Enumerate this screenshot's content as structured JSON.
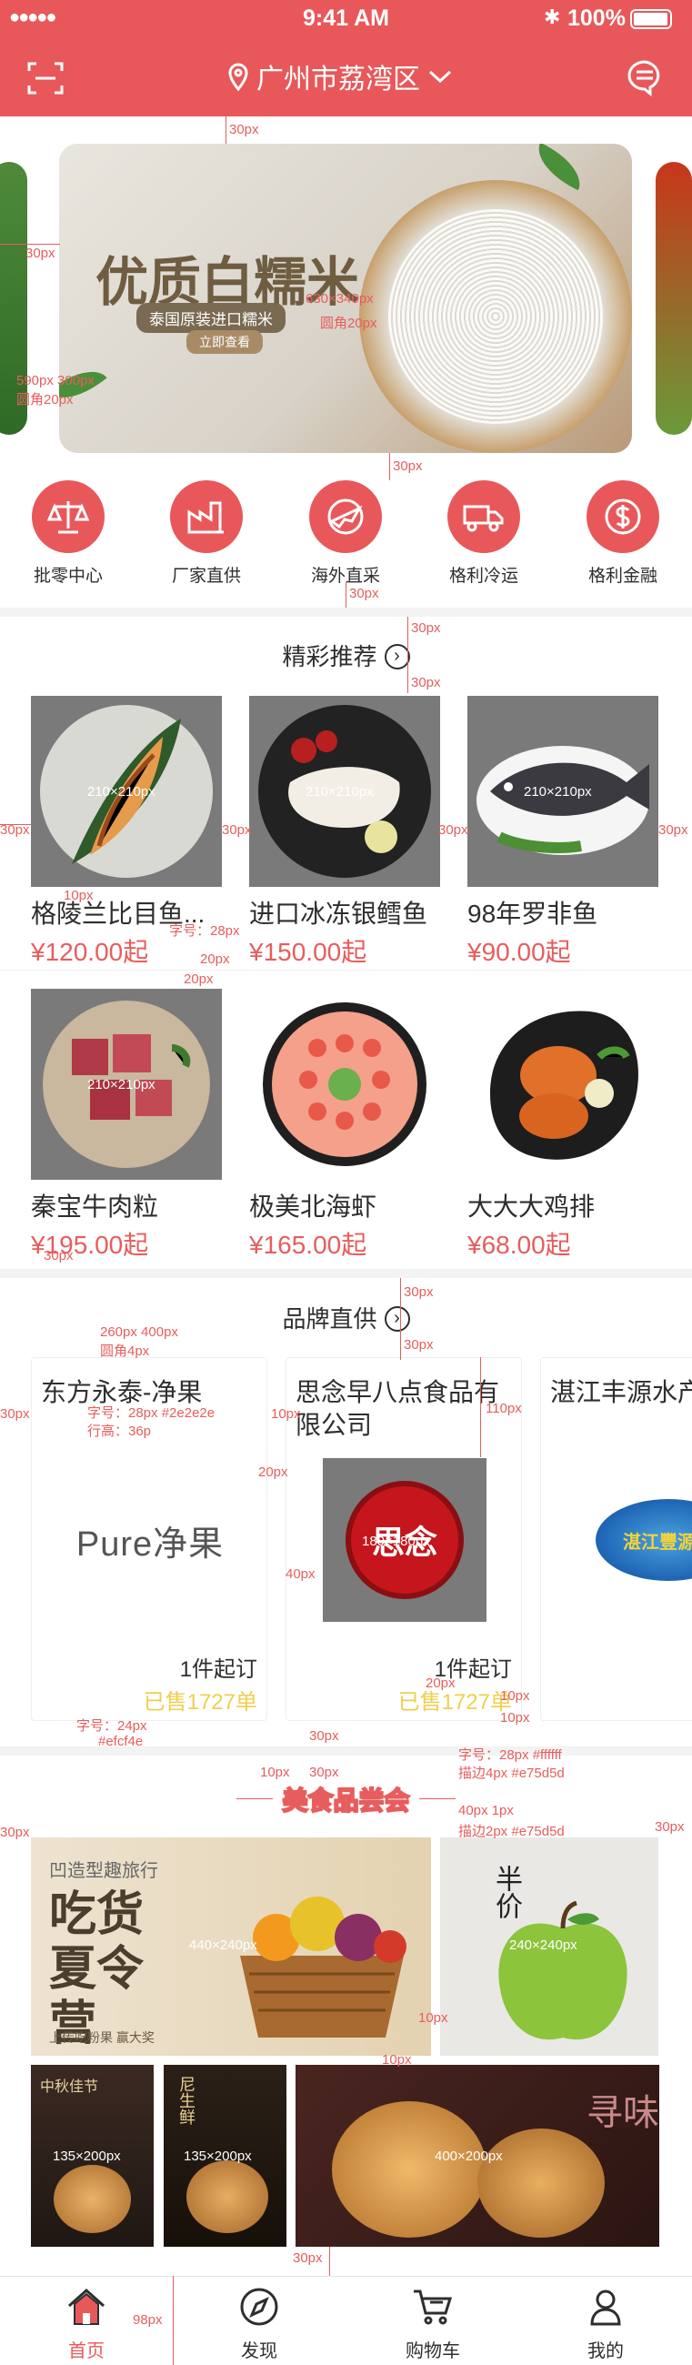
{
  "status_bar": {
    "signal": "●●●●●",
    "time": "9:41 AM",
    "battery": "100%"
  },
  "nav": {
    "location": "广州市荔湾区"
  },
  "banner": {
    "title": "优质白糯米",
    "subtitle": "泰国原装进口糯米",
    "button": "立即查看"
  },
  "categories": [
    {
      "label": "批零中心",
      "icon": "scale-icon"
    },
    {
      "label": "厂家直供",
      "icon": "factory-icon"
    },
    {
      "label": "海外直采",
      "icon": "plane-icon"
    },
    {
      "label": "格利冷运",
      "icon": "truck-icon"
    },
    {
      "label": "格利金融",
      "icon": "dollar-icon"
    }
  ],
  "featured": {
    "title": "精彩推荐",
    "products": [
      {
        "name": "格陵兰比目鱼...",
        "price": "¥120.00起"
      },
      {
        "name": "进口冰冻银鳕鱼",
        "price": "¥150.00起"
      },
      {
        "name": "98年罗非鱼",
        "price": "¥90.00起"
      },
      {
        "name": "秦宝牛肉粒",
        "price": "¥195.00起"
      },
      {
        "name": "极美北海虾",
        "price": "¥165.00起"
      },
      {
        "name": "大大大鸡排",
        "price": "¥68.00起"
      }
    ]
  },
  "brands": {
    "title": "品牌直供",
    "items": [
      {
        "name": "东方永泰-净果",
        "logo": "Pure净果",
        "min": "1件起订",
        "sold": "已售1727单"
      },
      {
        "name": "思念早八点食品有限公司",
        "logo": "思念",
        "min": "1件起订",
        "sold": "已售1727单"
      },
      {
        "name": "湛江丰源水产",
        "logo": "湛江豐源水",
        "min": "",
        "sold": ""
      }
    ]
  },
  "meeting": {
    "title": "美食品尝会",
    "tiles": [
      {
        "text": "凹造型趣旅行",
        "big": "吃货夏令营",
        "small": "上传吃粉果 赢大奖"
      },
      {
        "text": "半价"
      },
      {
        "text": "中秋佳节"
      },
      {
        "text": "尼生鲜"
      },
      {
        "text": "寻味"
      }
    ]
  },
  "tabbar": [
    {
      "label": "首页"
    },
    {
      "label": "发现"
    },
    {
      "label": "购物车"
    },
    {
      "label": "我的"
    }
  ],
  "annotations": {
    "a1": "30px",
    "a2": "30px",
    "a3": "630×340px",
    "a4": "圆角20px",
    "a5": "30px",
    "a6": "590px 300px",
    "a7": "圆角20px",
    "a8": "30px",
    "a9": "30px",
    "a10": "30px",
    "a11": "210×210px",
    "a12": "210×210px",
    "a13": "210×210px",
    "a14": "30px",
    "a15": "30px",
    "a16": "30px",
    "a17": "30px",
    "a18": "10px",
    "a19": "字号：28px",
    "a20": "20px",
    "a21": "20px",
    "a22": "210×210px",
    "a23": "30px",
    "a24": "30px",
    "a25": "30px",
    "a26": "260px 400px",
    "a27": "圆角4px",
    "a28": "30px",
    "a29": "字号：28px  #2e2e2e",
    "a30": "行高：36p",
    "a31": "10px",
    "a32": "110px",
    "a33": "20px",
    "a34": "40px",
    "a35": "180×180px",
    "a36": "20px",
    "a37": "10px",
    "a38": "10px",
    "a39": "字号：24px",
    "a40": "#efcf4e",
    "a41": "30px",
    "a42": "字号：28px  #ffffff",
    "a43": "描边4px  #e75d5d",
    "a44": "10px",
    "a45": "30px",
    "a46": "40px   1px",
    "a47": "描边2px  #e75d5d",
    "a48": "30px",
    "a49": "30px",
    "a50": "440×240px",
    "a51": "240×240px",
    "a52": "10px",
    "a53": "10px",
    "a54": "135×200px",
    "a55": "135×200px",
    "a56": "400×200px",
    "a57": "30px",
    "a58": "98px"
  },
  "colors": {
    "brand": "#e8585a",
    "price": "#e75d5d",
    "text": "#2e2e2e",
    "sold": "#efcf4e"
  }
}
